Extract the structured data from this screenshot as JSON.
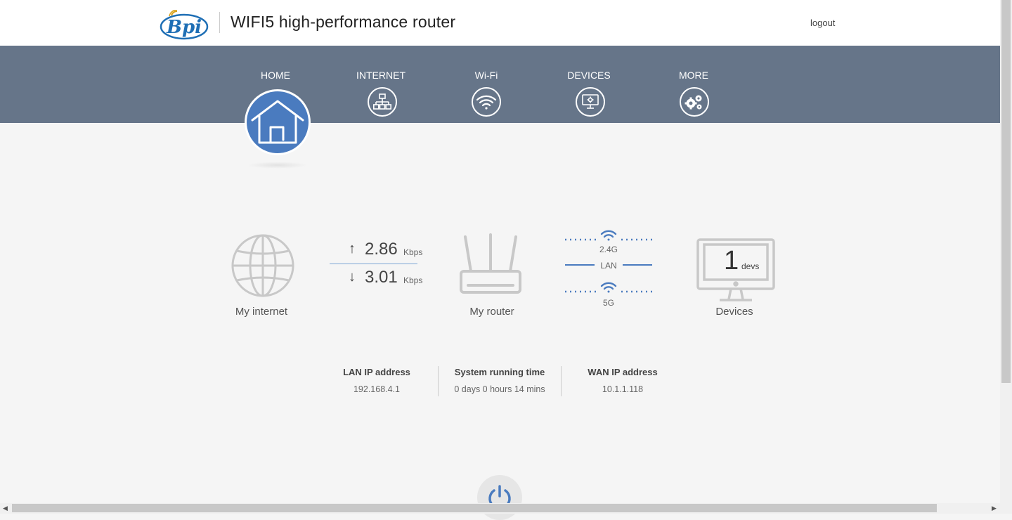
{
  "header": {
    "logo_text": "Bpi",
    "title": "WIFI5 high-performance router",
    "logout_label": "logout"
  },
  "nav": {
    "items": [
      {
        "label": "HOME",
        "icon": "home-icon",
        "active": true
      },
      {
        "label": "INTERNET",
        "icon": "network-icon"
      },
      {
        "label": "Wi-Fi",
        "icon": "wifi-icon"
      },
      {
        "label": "DEVICES",
        "icon": "monitor-icon"
      },
      {
        "label": "MORE",
        "icon": "gears-icon"
      }
    ]
  },
  "status": {
    "internet_label": "My internet",
    "upload_value": "2.86",
    "upload_unit": "Kbps",
    "download_value": "3.01",
    "download_unit": "Kbps",
    "router_label": "My router",
    "band_24": "2.4G",
    "band_lan": "LAN",
    "band_5": "5G",
    "devices_count": "1",
    "devices_unit": "devs",
    "devices_label": "Devices"
  },
  "info": {
    "lan_title": "LAN IP address",
    "lan_value": "192.168.4.1",
    "uptime_title": "System running time",
    "uptime_value": "0 days 0 hours 14 mins",
    "wan_title": "WAN IP address",
    "wan_value": "10.1.1.118"
  },
  "colors": {
    "navbar": "#667589",
    "accent": "#4a7bbf",
    "background": "#f5f5f5"
  }
}
